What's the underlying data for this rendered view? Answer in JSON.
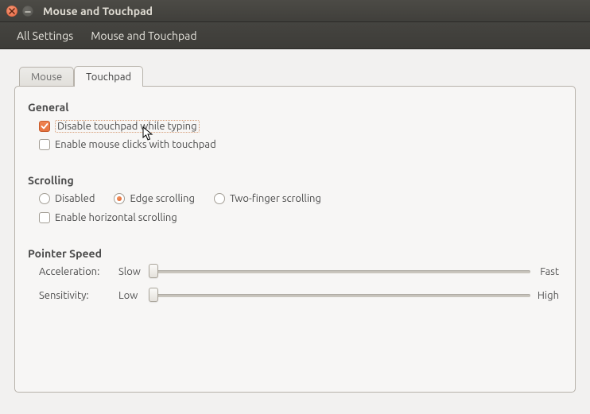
{
  "titlebar": {
    "title": "Mouse and Touchpad"
  },
  "toolbar": {
    "all_settings": "All Settings",
    "crumb": "Mouse and Touchpad"
  },
  "tabs": {
    "mouse": "Mouse",
    "touchpad": "Touchpad",
    "active": "touchpad"
  },
  "sections": {
    "general": {
      "title": "General",
      "disable_while_typing": {
        "label": "Disable touchpad while typing",
        "checked": true
      },
      "enable_mouse_clicks": {
        "label": "Enable mouse clicks with touchpad",
        "checked": false
      }
    },
    "scrolling": {
      "title": "Scrolling",
      "options": {
        "disabled": "Disabled",
        "edge": "Edge scrolling",
        "two_finger": "Two-finger scrolling",
        "selected": "edge"
      },
      "horizontal": {
        "label": "Enable horizontal scrolling",
        "checked": false
      }
    },
    "pointer_speed": {
      "title": "Pointer Speed",
      "acceleration": {
        "label": "Acceleration:",
        "low": "Slow",
        "high": "Fast",
        "value": 0.02
      },
      "sensitivity": {
        "label": "Sensitivity:",
        "low": "Low",
        "high": "High",
        "value": 0.02
      }
    }
  }
}
